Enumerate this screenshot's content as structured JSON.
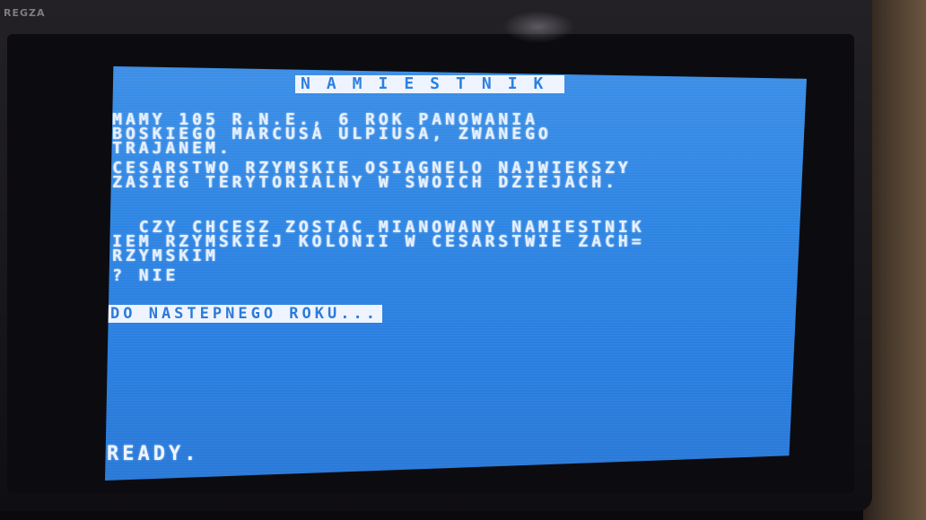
{
  "tv": {
    "brand": "REGZA"
  },
  "screen": {
    "title": "NAMIESTNIK",
    "lines": [
      "MAMY 105 R.N.E., 6 ROK PANOWANIA",
      "BOSKIEGO MARCUSA ULPIUSA, ZWANEGO",
      "TRAJANEM.",
      "CESARSTWO RZYMSKIE OSIAGNELO NAJWIEKSZY",
      "ZASIEG TERYTORIALNY W SWOICH DZIEJACH.",
      "",
      "  CZY CHCESZ ZOSTAC MIANOWANY NAMIESTNIK",
      "IEM RZYMSKIEJ KOLONII W CESARSTWIE ZACH=",
      "RZYMSKIM",
      "? NIE"
    ],
    "inverse_line": "DO NASTEPNEGO ROKU...",
    "ready": "READY."
  },
  "colors": {
    "screen_background": "#2a7fe0",
    "screen_text": "#e6f0ff",
    "bezel": "#17161a"
  }
}
